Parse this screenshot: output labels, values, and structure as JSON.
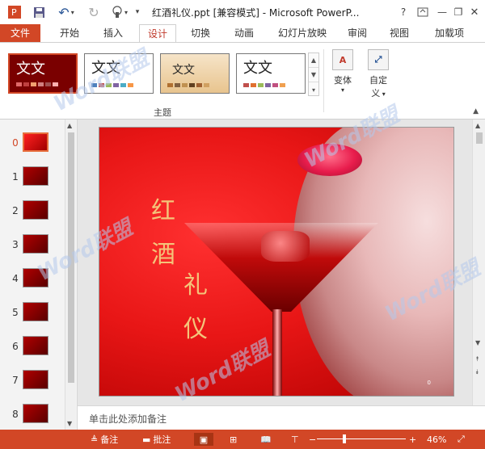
{
  "app": {
    "window_title": "红酒礼仪.ppt [兼容模式] - Microsoft PowerP...",
    "quick_access": {
      "save_icon": "save-icon",
      "undo_icon": "undo-icon",
      "redo_icon": "redo-icon",
      "touch_icon": "touch-mode-icon",
      "customize_icon": "customize-qat-icon"
    },
    "window_controls": {
      "help": "?",
      "minimize": "—",
      "restore": "❐",
      "close": "✕"
    }
  },
  "ribbon": {
    "tabs": [
      "文件",
      "开始",
      "插入",
      "设计",
      "切换",
      "动画",
      "幻灯片放映",
      "审阅",
      "视图",
      "加载项"
    ],
    "active_tab": "设计",
    "themes_group_label": "主题",
    "theme_sample_text": "文文",
    "variant_button": "变体",
    "customize_button_line1": "自定",
    "customize_button_line2": "义"
  },
  "thumbnails": {
    "numbers": [
      "0",
      "1",
      "2",
      "3",
      "4",
      "5",
      "6",
      "7",
      "8"
    ],
    "selected": "0"
  },
  "slide": {
    "title_chars": [
      "红",
      "酒",
      "礼",
      "仪"
    ],
    "number": "0"
  },
  "notes": {
    "placeholder": "单击此处添加备注"
  },
  "statusbar": {
    "notes": "备注",
    "comments": "批注",
    "zoom_minus": "−",
    "zoom_plus": "+",
    "zoom_percent": "46%"
  },
  "watermark": {
    "text": "Word联盟"
  },
  "colors": {
    "accent": "#d24726",
    "slide_bg": "#e81616",
    "title_gold": "#f4c47a"
  }
}
